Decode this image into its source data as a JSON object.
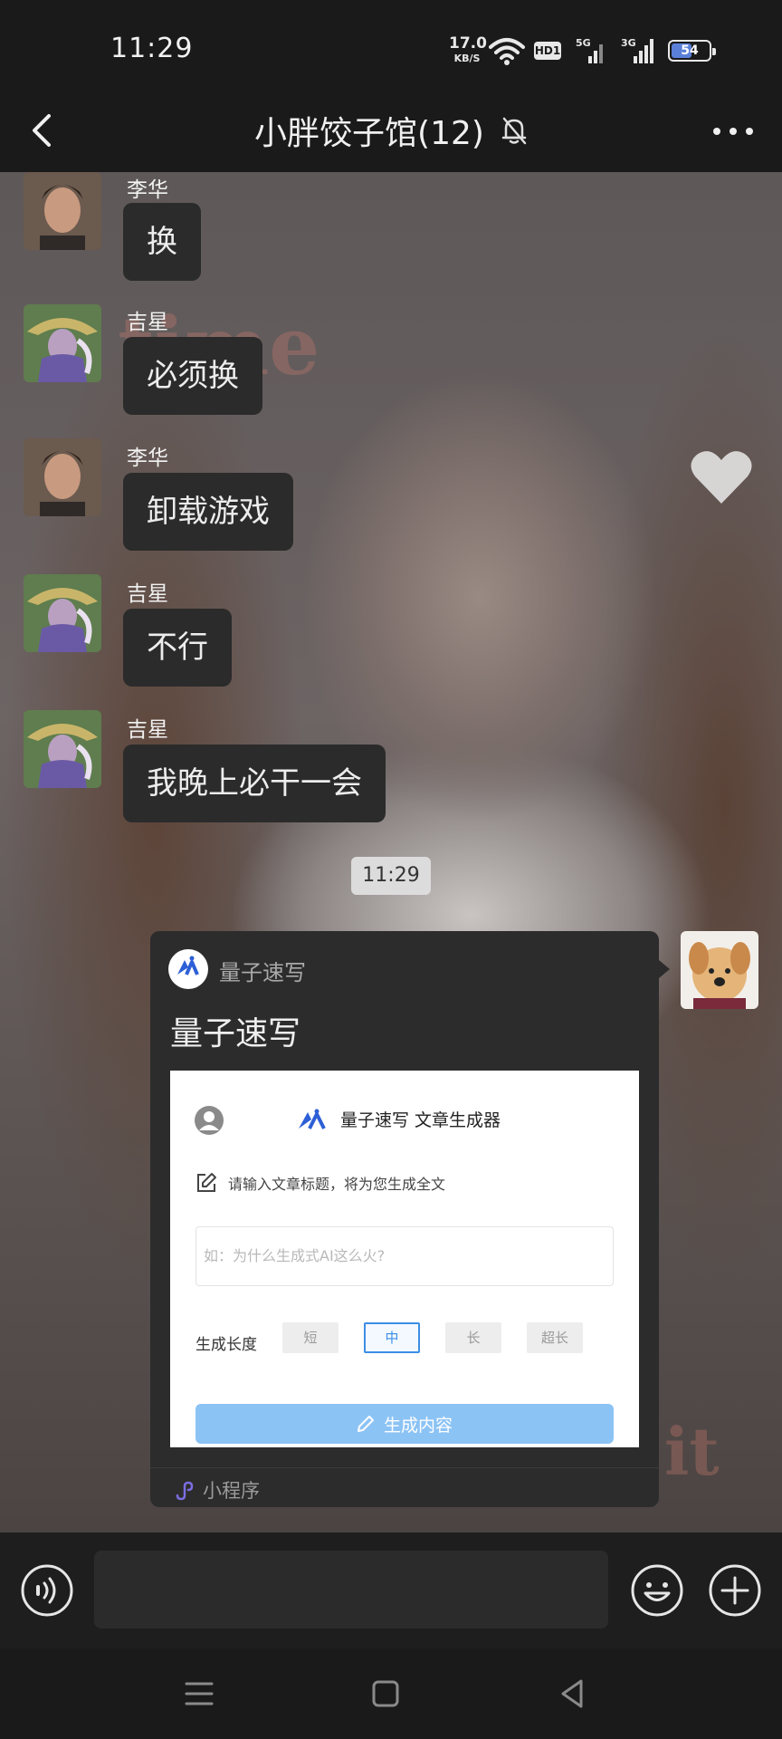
{
  "status_bar": {
    "time": "11:29",
    "net_speed_value": "17.0",
    "net_speed_unit": "KB/S",
    "hd_badge": "HD1",
    "sim1_label": "5G",
    "sim2_label": "3G",
    "battery_percent": 54,
    "battery_text": "54",
    "icons": [
      "wifi-icon",
      "signal-icon",
      "signal-icon",
      "battery-icon"
    ]
  },
  "header": {
    "title": "小胖饺子馆(12)",
    "icons": [
      "back-icon",
      "bell-muted-icon",
      "more-icon"
    ]
  },
  "messages": [
    {
      "sender": "李华",
      "text": "换",
      "avatar": "avatar-lihua"
    },
    {
      "sender": "吉星",
      "text": "必须换",
      "avatar": "avatar-jixing"
    },
    {
      "sender": "李华",
      "text": "卸载游戏",
      "avatar": "avatar-lihua"
    },
    {
      "sender": "吉星",
      "text": "不行",
      "avatar": "avatar-jixing"
    },
    {
      "sender": "吉星",
      "text": "我晚上必干一会",
      "avatar": "avatar-jixing"
    }
  ],
  "timestamp": "11:29",
  "mini_program": {
    "brand": "量子速写",
    "title": "量子速写",
    "preview": {
      "header": "量子速写 文章生成器",
      "prompt": "请输入文章标题，将为您生成全文",
      "input_placeholder": "如：为什么生成式AI这么火?",
      "length_label": "生成长度",
      "length_options": [
        "短",
        "中",
        "长",
        "超长"
      ],
      "selected_length": "中",
      "generate_label": "生成内容",
      "accent": "#3c8ee6"
    },
    "footer_label": "小程序"
  },
  "background_text": {
    "word1": "time",
    "word2": "it"
  },
  "input_bar": {
    "icons": [
      "voice-icon",
      "emoji-icon",
      "plus-icon"
    ]
  },
  "nav_bar": {
    "icons": [
      "menu-icon",
      "home-icon",
      "back-triangle-icon"
    ]
  }
}
